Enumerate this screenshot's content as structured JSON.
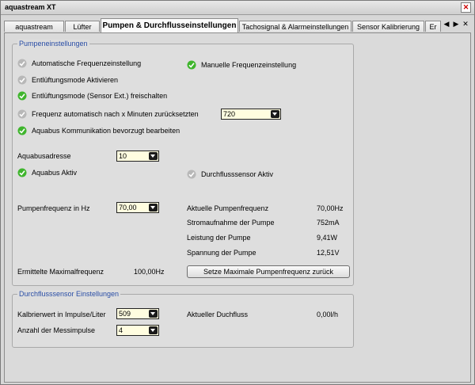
{
  "window": {
    "title": "aquastream XT"
  },
  "tabs": [
    {
      "label": "aquastream"
    },
    {
      "label": "Lüfter"
    },
    {
      "label": "Pumpen & Durchflusseinstellungen"
    },
    {
      "label": "Tachosignal & Alarmeinstellungen"
    },
    {
      "label": "Sensor Kalibrierung"
    },
    {
      "label": "Er"
    }
  ],
  "pump_settings": {
    "group_title": "Pumpeneinstellungen",
    "auto_freq": {
      "label": "Automatische Frequenzeinstellung",
      "checked": false
    },
    "manual_freq": {
      "label": "Manuelle Frequenzeinstellung",
      "checked": true
    },
    "vent_mode": {
      "label": "Entlüftungsmode Aktivieren",
      "checked": false
    },
    "vent_mode_sensor": {
      "label": "Entlüftungsmode (Sensor Ext.) freischalten",
      "checked": true
    },
    "freq_reset": {
      "label": "Frequenz automatisch nach x Minuten zurücksetzten",
      "checked": false,
      "value": "720"
    },
    "aquabus_pref": {
      "label": "Aquabus Kommunikation bevorzugt bearbeiten",
      "checked": true
    },
    "aquabus_address": {
      "label": "Aquabusadresse",
      "value": "10"
    },
    "aquabus_active": {
      "label": "Aquabus Aktiv",
      "checked": true
    },
    "flow_sensor_active": {
      "label": "Durchflusssensor Aktiv",
      "checked": false
    },
    "pump_freq": {
      "label": "Pumpenfrequenz in Hz",
      "value": "70,00"
    },
    "readings": [
      {
        "label": "Aktuelle Pumpenfrequenz",
        "value": "70,00Hz"
      },
      {
        "label": "Stromaufnahme der Pumpe",
        "value": "752mA"
      },
      {
        "label": "Leistung der Pumpe",
        "value": "9,41W"
      },
      {
        "label": "Spannung der Pumpe",
        "value": "12,51V"
      }
    ],
    "max_freq": {
      "label": "Ermittelte Maximalfrequenz",
      "value": "100,00Hz"
    },
    "set_max_button": "Setze Maximale Pumpenfrequenz zurück"
  },
  "flow_settings": {
    "group_title": "Durchflusssensor Einstellungen",
    "calibration": {
      "label": "Kalbrierwert in Impulse/Liter",
      "value": "509"
    },
    "current_flow": {
      "label": "Aktueller Duchfluss",
      "value": "0,00l/h"
    },
    "pulses": {
      "label": "Anzahl der Messimpulse",
      "value": "4"
    }
  },
  "colors": {
    "checked": "#3fb52d",
    "unchecked": "#b8b8b8",
    "group_title": "#2a4ea6",
    "combo_bg": "#fffde0"
  }
}
